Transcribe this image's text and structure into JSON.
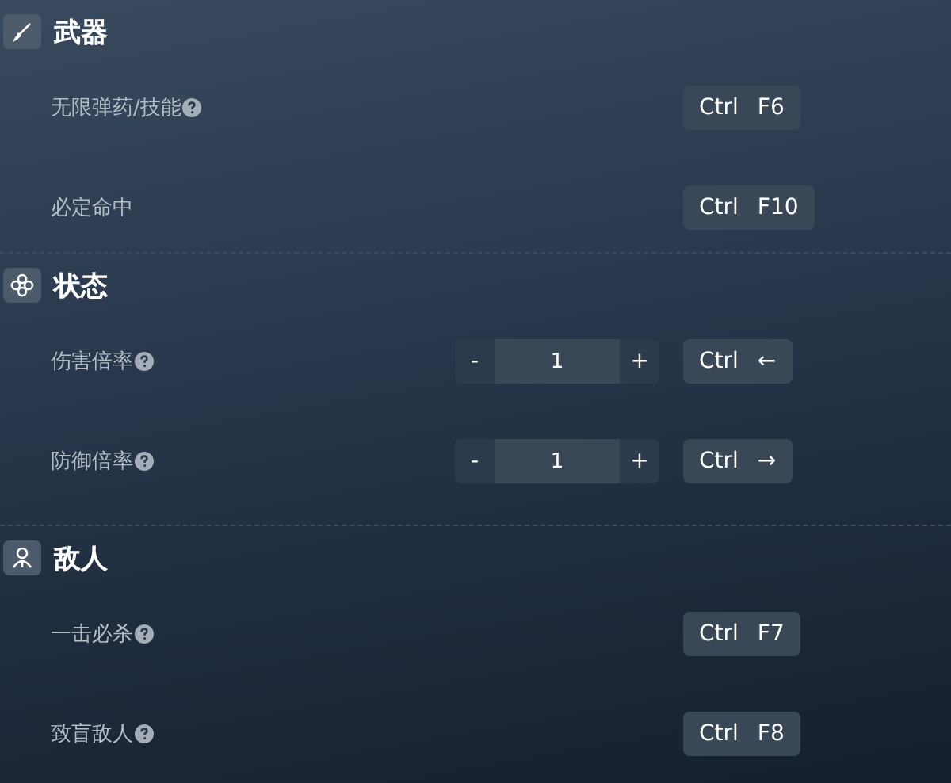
{
  "sections": [
    {
      "title": "武器",
      "kind": "brush",
      "items": [
        {
          "label": "无限弹药/技能",
          "help": true,
          "kind": "toggle",
          "hotkey": [
            "Ctrl",
            "F6"
          ]
        },
        {
          "label": "必定命中",
          "help": false,
          "kind": "toggle",
          "hotkey": [
            "Ctrl",
            "F10"
          ]
        }
      ]
    },
    {
      "title": "状态",
      "kind": "clover",
      "items": [
        {
          "label": "伤害倍率",
          "help": true,
          "kind": "stepper",
          "minus": "-",
          "value": "1",
          "plus": "+",
          "hotkey": [
            "Ctrl",
            "←"
          ]
        },
        {
          "label": "防御倍率",
          "help": true,
          "kind": "stepper",
          "minus": "-",
          "value": "1",
          "plus": "+",
          "hotkey": [
            "Ctrl",
            "→"
          ]
        }
      ]
    },
    {
      "title": "敌人",
      "kind": "person",
      "items": [
        {
          "label": "一击必杀",
          "help": true,
          "kind": "toggle",
          "hotkey": [
            "Ctrl",
            "F7"
          ]
        },
        {
          "label": "致盲敌人",
          "help": true,
          "kind": "toggle",
          "hotkey": [
            "Ctrl",
            "F8"
          ]
        }
      ]
    }
  ]
}
